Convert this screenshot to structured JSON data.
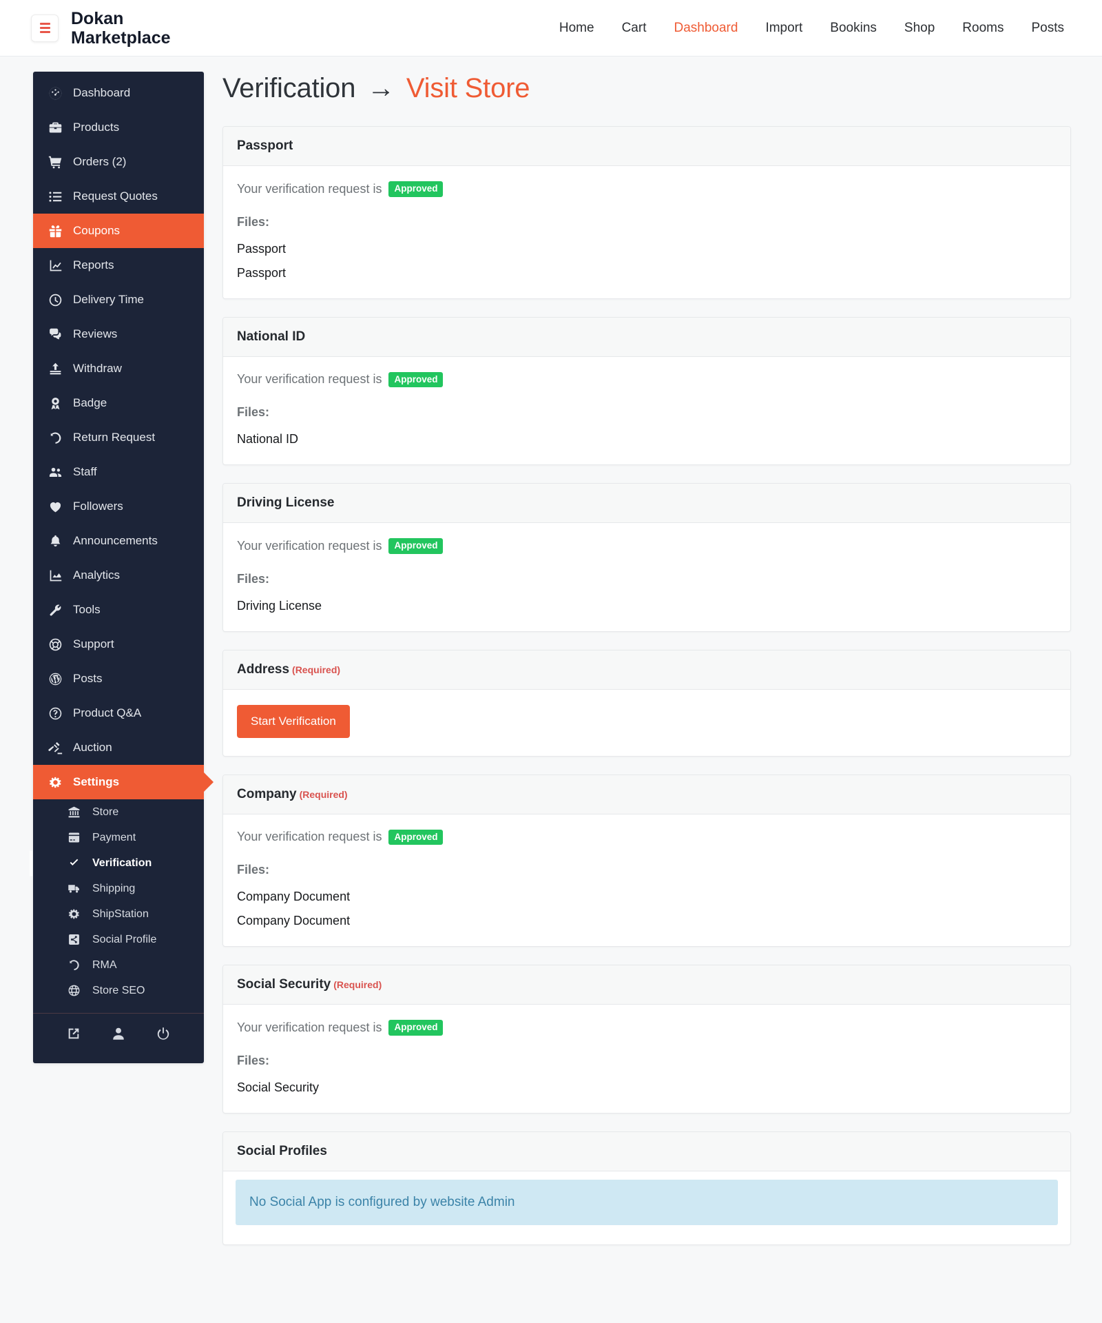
{
  "topbar": {
    "menu_icon": "hamburger-icon",
    "brand_line1": "Dokan",
    "brand_line2": "Marketplace",
    "nav": [
      {
        "label": "Home",
        "active": false
      },
      {
        "label": "Cart",
        "active": false
      },
      {
        "label": "Dashboard",
        "active": true
      },
      {
        "label": "Import",
        "active": false
      },
      {
        "label": "Bookins",
        "active": false
      },
      {
        "label": "Shop",
        "active": false
      },
      {
        "label": "Rooms",
        "active": false
      },
      {
        "label": "Posts",
        "active": false
      }
    ]
  },
  "sidebar": {
    "items": [
      {
        "label": "Dashboard",
        "icon": "gauge-icon"
      },
      {
        "label": "Products",
        "icon": "briefcase-icon"
      },
      {
        "label": "Orders (2)",
        "icon": "cart-icon"
      },
      {
        "label": "Request Quotes",
        "icon": "list-icon"
      },
      {
        "label": "Coupons",
        "icon": "gift-icon"
      },
      {
        "label": "Reports",
        "icon": "chart-line-icon"
      },
      {
        "label": "Delivery Time",
        "icon": "clock-icon"
      },
      {
        "label": "Reviews",
        "icon": "comments-icon"
      },
      {
        "label": "Withdraw",
        "icon": "upload-icon"
      },
      {
        "label": "Badge",
        "icon": "award-icon"
      },
      {
        "label": "Return Request",
        "icon": "undo-icon"
      },
      {
        "label": "Staff",
        "icon": "users-icon"
      },
      {
        "label": "Followers",
        "icon": "heart-icon"
      },
      {
        "label": "Announcements",
        "icon": "bell-icon"
      },
      {
        "label": "Analytics",
        "icon": "chart-area-icon"
      },
      {
        "label": "Tools",
        "icon": "wrench-icon"
      },
      {
        "label": "Support",
        "icon": "lifering-icon"
      },
      {
        "label": "Posts",
        "icon": "wordpress-icon"
      },
      {
        "label": "Product Q&A",
        "icon": "question-circle-icon"
      },
      {
        "label": "Auction",
        "icon": "gavel-icon"
      },
      {
        "label": "Settings",
        "icon": "gear-icon"
      }
    ],
    "active_label": "Coupons",
    "settings_label": "Settings",
    "submenu": [
      {
        "label": "Store",
        "icon": "bank-icon"
      },
      {
        "label": "Payment",
        "icon": "credit-card-icon"
      },
      {
        "label": "Verification",
        "icon": "check-icon"
      },
      {
        "label": "Shipping",
        "icon": "truck-icon"
      },
      {
        "label": "ShipStation",
        "icon": "cog-icon"
      },
      {
        "label": "Social Profile",
        "icon": "share-icon"
      },
      {
        "label": "RMA",
        "icon": "undo-icon"
      },
      {
        "label": "Store SEO",
        "icon": "globe-icon"
      }
    ],
    "submenu_current": "Verification",
    "bottom_icons": [
      {
        "name": "external-link-icon"
      },
      {
        "name": "user-icon"
      },
      {
        "name": "power-off-icon"
      }
    ]
  },
  "page": {
    "title": "Verification",
    "arrow": "→",
    "visit_store": "Visit Store"
  },
  "colors": {
    "accent": "#ef5b34",
    "sidebar_bg": "#1c2438",
    "approved_green": "#22c55e",
    "required_red": "#d9534f",
    "notice_bg": "#cfe8f3",
    "notice_text": "#3b83a8"
  },
  "labels": {
    "status_prefix": "Your verification request is",
    "files": "Files:",
    "required": "(Required)",
    "start_verification": "Start Verification"
  },
  "cards": [
    {
      "title": "Passport",
      "required": false,
      "status": "Approved",
      "has_status": true,
      "files": [
        "Passport",
        "Passport"
      ],
      "action": null,
      "notice": null
    },
    {
      "title": "National ID",
      "required": false,
      "status": "Approved",
      "has_status": true,
      "files": [
        "National ID"
      ],
      "action": null,
      "notice": null
    },
    {
      "title": "Driving License",
      "required": false,
      "status": "Approved",
      "has_status": true,
      "files": [
        "Driving License"
      ],
      "action": null,
      "notice": null
    },
    {
      "title": "Address",
      "required": true,
      "status": null,
      "has_status": false,
      "files": [],
      "action": "Start Verification",
      "notice": null
    },
    {
      "title": "Company",
      "required": true,
      "status": "Approved",
      "has_status": true,
      "files": [
        "Company Document",
        "Company Document"
      ],
      "action": null,
      "notice": null
    },
    {
      "title": "Social Security",
      "required": true,
      "status": "Approved",
      "has_status": true,
      "files": [
        "Social Security"
      ],
      "action": null,
      "notice": null
    },
    {
      "title": "Social Profiles",
      "required": false,
      "status": null,
      "has_status": false,
      "files": [],
      "action": null,
      "notice": "No Social App is configured by website Admin"
    }
  ]
}
